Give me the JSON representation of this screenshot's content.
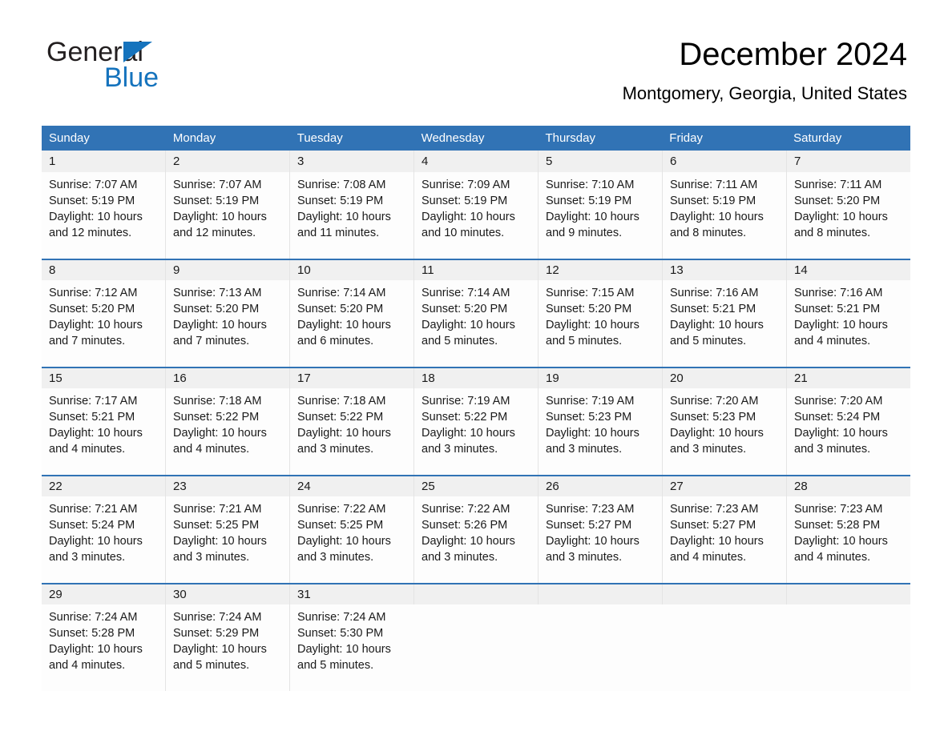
{
  "brand": {
    "name_part1": "General",
    "name_part2": "Blue",
    "triangle_color": "#1573bd"
  },
  "header": {
    "title": "December 2024",
    "subtitle": "Montgomery, Georgia, United States",
    "accent_color": "#3173b5",
    "band_color": "#f0f0f0"
  },
  "weekdays": [
    "Sunday",
    "Monday",
    "Tuesday",
    "Wednesday",
    "Thursday",
    "Friday",
    "Saturday"
  ],
  "weeks": [
    [
      {
        "day": "1",
        "sunrise": "Sunrise: 7:07 AM",
        "sunset": "Sunset: 5:19 PM",
        "daylight1": "Daylight: 10 hours",
        "daylight2": "and 12 minutes."
      },
      {
        "day": "2",
        "sunrise": "Sunrise: 7:07 AM",
        "sunset": "Sunset: 5:19 PM",
        "daylight1": "Daylight: 10 hours",
        "daylight2": "and 12 minutes."
      },
      {
        "day": "3",
        "sunrise": "Sunrise: 7:08 AM",
        "sunset": "Sunset: 5:19 PM",
        "daylight1": "Daylight: 10 hours",
        "daylight2": "and 11 minutes."
      },
      {
        "day": "4",
        "sunrise": "Sunrise: 7:09 AM",
        "sunset": "Sunset: 5:19 PM",
        "daylight1": "Daylight: 10 hours",
        "daylight2": "and 10 minutes."
      },
      {
        "day": "5",
        "sunrise": "Sunrise: 7:10 AM",
        "sunset": "Sunset: 5:19 PM",
        "daylight1": "Daylight: 10 hours",
        "daylight2": "and 9 minutes."
      },
      {
        "day": "6",
        "sunrise": "Sunrise: 7:11 AM",
        "sunset": "Sunset: 5:19 PM",
        "daylight1": "Daylight: 10 hours",
        "daylight2": "and 8 minutes."
      },
      {
        "day": "7",
        "sunrise": "Sunrise: 7:11 AM",
        "sunset": "Sunset: 5:20 PM",
        "daylight1": "Daylight: 10 hours",
        "daylight2": "and 8 minutes."
      }
    ],
    [
      {
        "day": "8",
        "sunrise": "Sunrise: 7:12 AM",
        "sunset": "Sunset: 5:20 PM",
        "daylight1": "Daylight: 10 hours",
        "daylight2": "and 7 minutes."
      },
      {
        "day": "9",
        "sunrise": "Sunrise: 7:13 AM",
        "sunset": "Sunset: 5:20 PM",
        "daylight1": "Daylight: 10 hours",
        "daylight2": "and 7 minutes."
      },
      {
        "day": "10",
        "sunrise": "Sunrise: 7:14 AM",
        "sunset": "Sunset: 5:20 PM",
        "daylight1": "Daylight: 10 hours",
        "daylight2": "and 6 minutes."
      },
      {
        "day": "11",
        "sunrise": "Sunrise: 7:14 AM",
        "sunset": "Sunset: 5:20 PM",
        "daylight1": "Daylight: 10 hours",
        "daylight2": "and 5 minutes."
      },
      {
        "day": "12",
        "sunrise": "Sunrise: 7:15 AM",
        "sunset": "Sunset: 5:20 PM",
        "daylight1": "Daylight: 10 hours",
        "daylight2": "and 5 minutes."
      },
      {
        "day": "13",
        "sunrise": "Sunrise: 7:16 AM",
        "sunset": "Sunset: 5:21 PM",
        "daylight1": "Daylight: 10 hours",
        "daylight2": "and 5 minutes."
      },
      {
        "day": "14",
        "sunrise": "Sunrise: 7:16 AM",
        "sunset": "Sunset: 5:21 PM",
        "daylight1": "Daylight: 10 hours",
        "daylight2": "and 4 minutes."
      }
    ],
    [
      {
        "day": "15",
        "sunrise": "Sunrise: 7:17 AM",
        "sunset": "Sunset: 5:21 PM",
        "daylight1": "Daylight: 10 hours",
        "daylight2": "and 4 minutes."
      },
      {
        "day": "16",
        "sunrise": "Sunrise: 7:18 AM",
        "sunset": "Sunset: 5:22 PM",
        "daylight1": "Daylight: 10 hours",
        "daylight2": "and 4 minutes."
      },
      {
        "day": "17",
        "sunrise": "Sunrise: 7:18 AM",
        "sunset": "Sunset: 5:22 PM",
        "daylight1": "Daylight: 10 hours",
        "daylight2": "and 3 minutes."
      },
      {
        "day": "18",
        "sunrise": "Sunrise: 7:19 AM",
        "sunset": "Sunset: 5:22 PM",
        "daylight1": "Daylight: 10 hours",
        "daylight2": "and 3 minutes."
      },
      {
        "day": "19",
        "sunrise": "Sunrise: 7:19 AM",
        "sunset": "Sunset: 5:23 PM",
        "daylight1": "Daylight: 10 hours",
        "daylight2": "and 3 minutes."
      },
      {
        "day": "20",
        "sunrise": "Sunrise: 7:20 AM",
        "sunset": "Sunset: 5:23 PM",
        "daylight1": "Daylight: 10 hours",
        "daylight2": "and 3 minutes."
      },
      {
        "day": "21",
        "sunrise": "Sunrise: 7:20 AM",
        "sunset": "Sunset: 5:24 PM",
        "daylight1": "Daylight: 10 hours",
        "daylight2": "and 3 minutes."
      }
    ],
    [
      {
        "day": "22",
        "sunrise": "Sunrise: 7:21 AM",
        "sunset": "Sunset: 5:24 PM",
        "daylight1": "Daylight: 10 hours",
        "daylight2": "and 3 minutes."
      },
      {
        "day": "23",
        "sunrise": "Sunrise: 7:21 AM",
        "sunset": "Sunset: 5:25 PM",
        "daylight1": "Daylight: 10 hours",
        "daylight2": "and 3 minutes."
      },
      {
        "day": "24",
        "sunrise": "Sunrise: 7:22 AM",
        "sunset": "Sunset: 5:25 PM",
        "daylight1": "Daylight: 10 hours",
        "daylight2": "and 3 minutes."
      },
      {
        "day": "25",
        "sunrise": "Sunrise: 7:22 AM",
        "sunset": "Sunset: 5:26 PM",
        "daylight1": "Daylight: 10 hours",
        "daylight2": "and 3 minutes."
      },
      {
        "day": "26",
        "sunrise": "Sunrise: 7:23 AM",
        "sunset": "Sunset: 5:27 PM",
        "daylight1": "Daylight: 10 hours",
        "daylight2": "and 3 minutes."
      },
      {
        "day": "27",
        "sunrise": "Sunrise: 7:23 AM",
        "sunset": "Sunset: 5:27 PM",
        "daylight1": "Daylight: 10 hours",
        "daylight2": "and 4 minutes."
      },
      {
        "day": "28",
        "sunrise": "Sunrise: 7:23 AM",
        "sunset": "Sunset: 5:28 PM",
        "daylight1": "Daylight: 10 hours",
        "daylight2": "and 4 minutes."
      }
    ],
    [
      {
        "day": "29",
        "sunrise": "Sunrise: 7:24 AM",
        "sunset": "Sunset: 5:28 PM",
        "daylight1": "Daylight: 10 hours",
        "daylight2": "and 4 minutes."
      },
      {
        "day": "30",
        "sunrise": "Sunrise: 7:24 AM",
        "sunset": "Sunset: 5:29 PM",
        "daylight1": "Daylight: 10 hours",
        "daylight2": "and 5 minutes."
      },
      {
        "day": "31",
        "sunrise": "Sunrise: 7:24 AM",
        "sunset": "Sunset: 5:30 PM",
        "daylight1": "Daylight: 10 hours",
        "daylight2": "and 5 minutes."
      },
      {
        "day": "",
        "sunrise": "",
        "sunset": "",
        "daylight1": "",
        "daylight2": ""
      },
      {
        "day": "",
        "sunrise": "",
        "sunset": "",
        "daylight1": "",
        "daylight2": ""
      },
      {
        "day": "",
        "sunrise": "",
        "sunset": "",
        "daylight1": "",
        "daylight2": ""
      },
      {
        "day": "",
        "sunrise": "",
        "sunset": "",
        "daylight1": "",
        "daylight2": ""
      }
    ]
  ]
}
